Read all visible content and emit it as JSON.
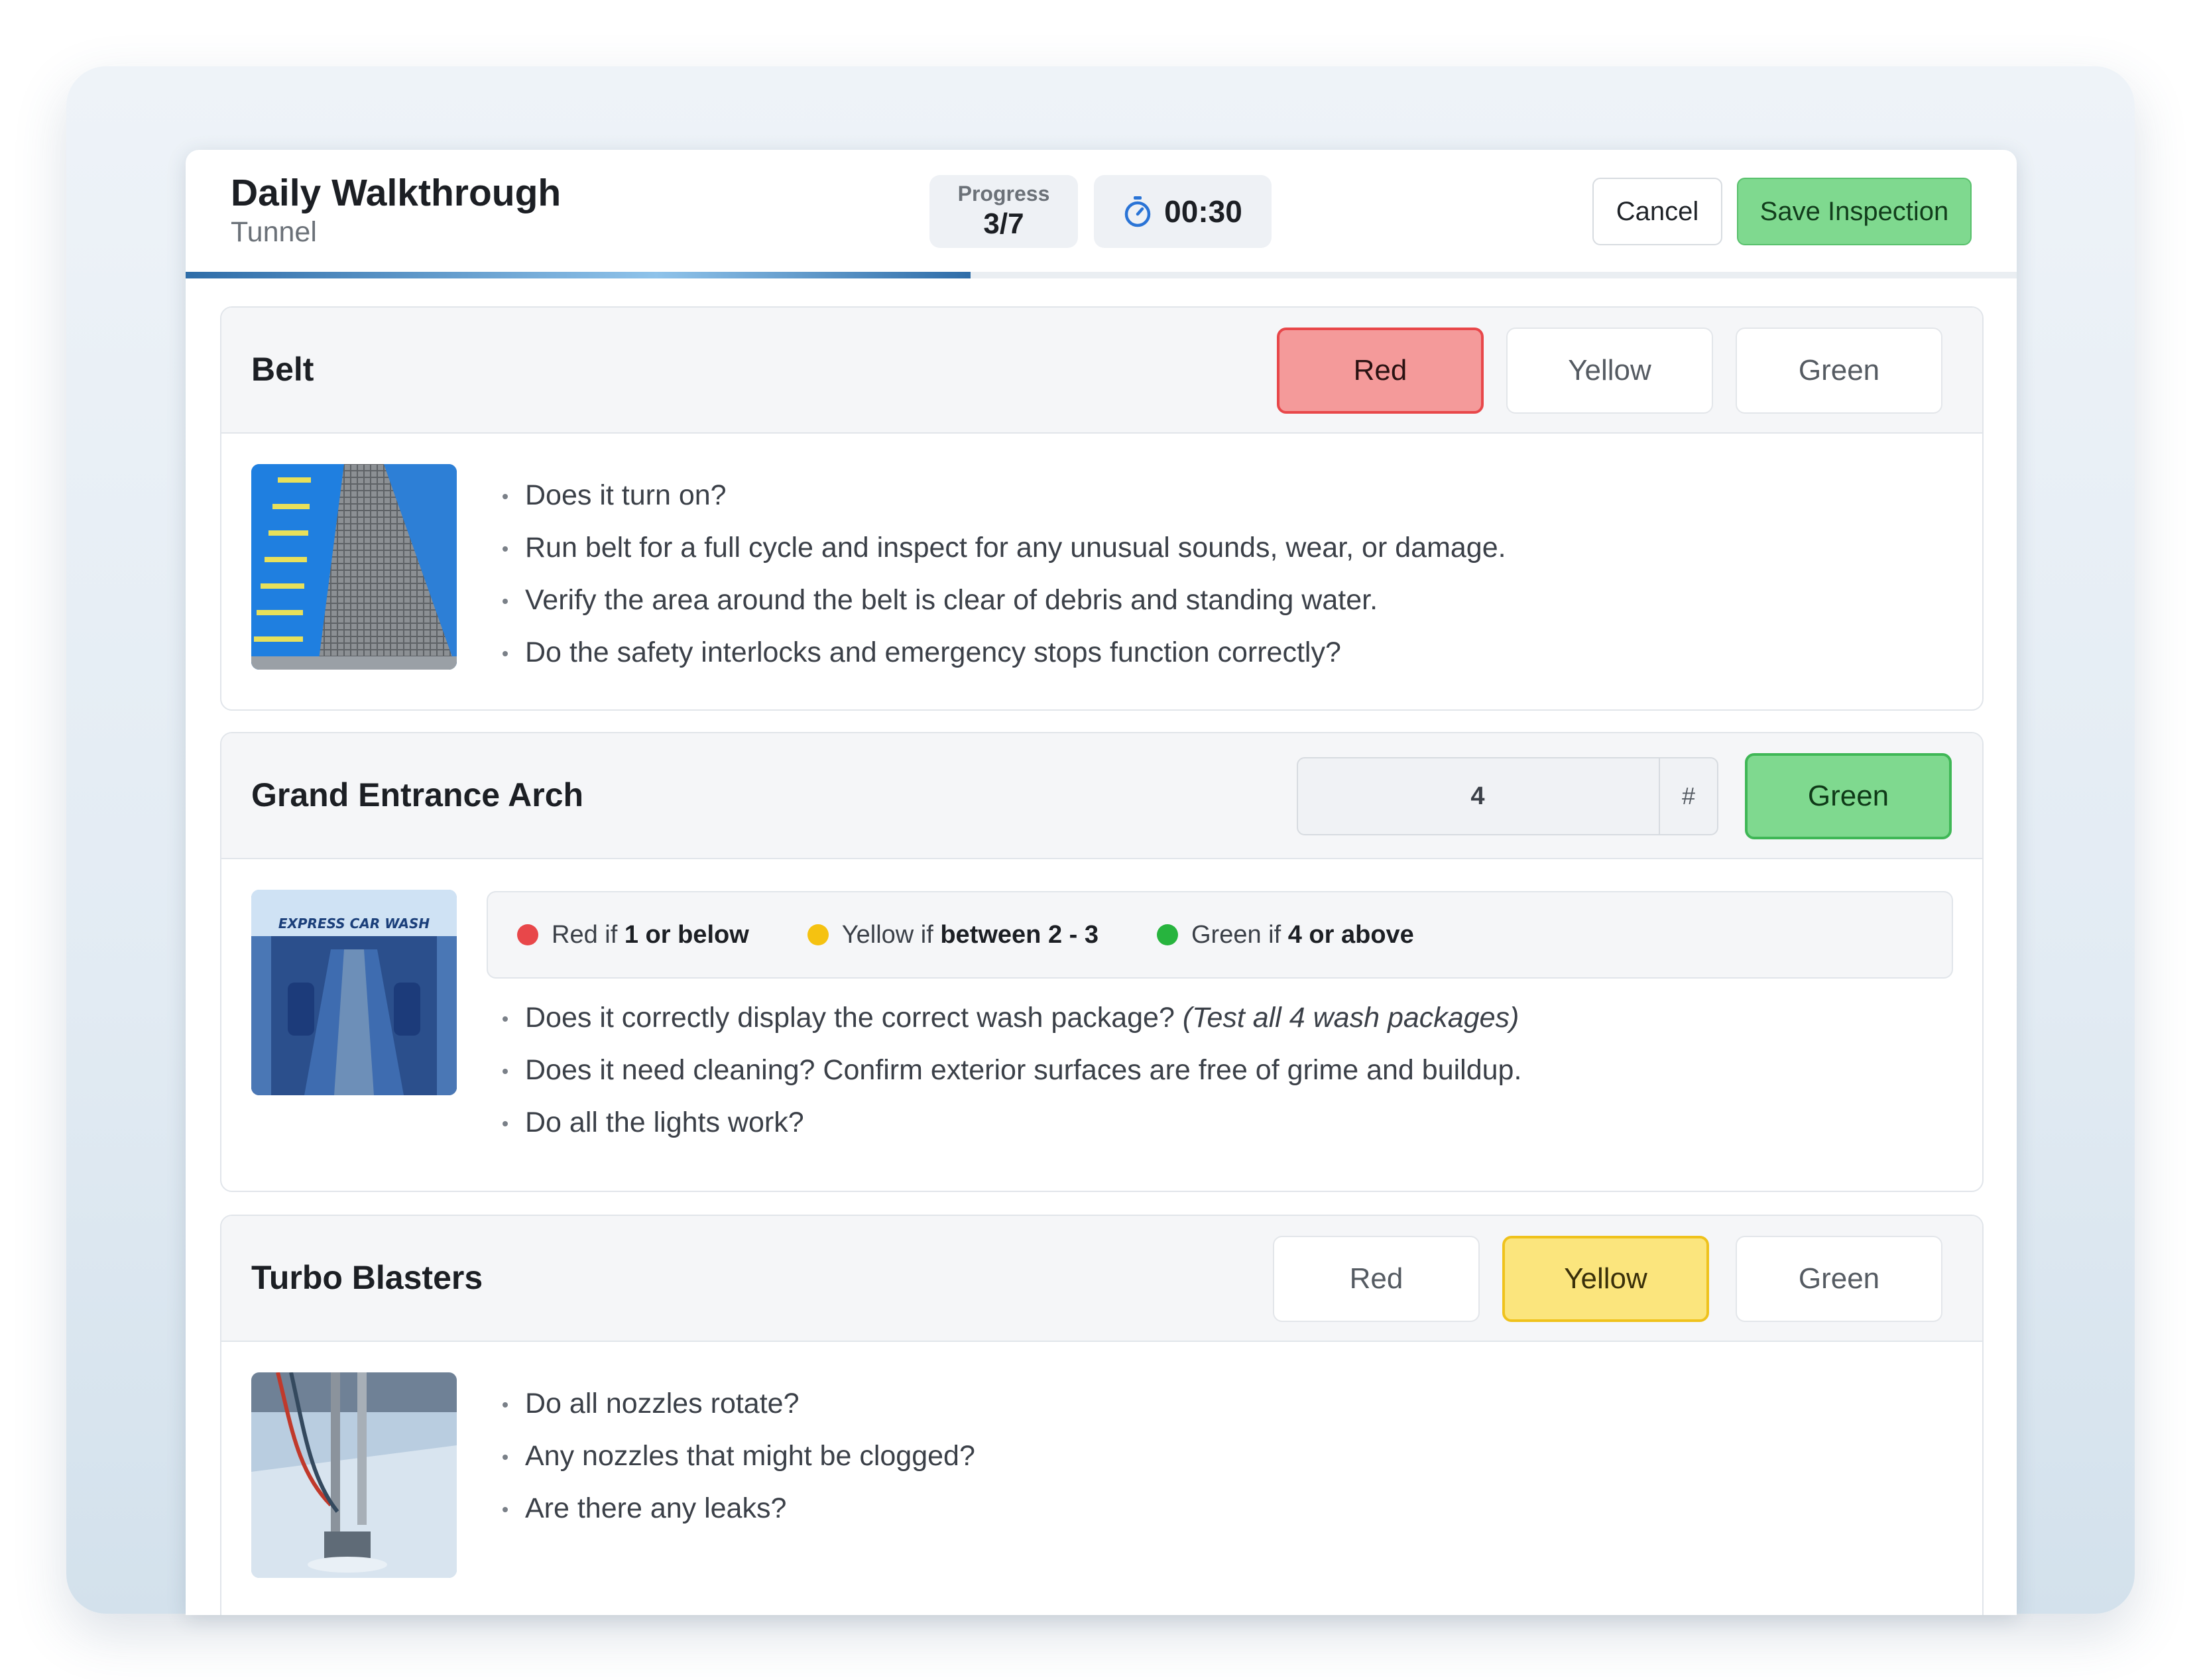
{
  "header": {
    "title": "Daily Walkthrough",
    "subtitle": "Tunnel",
    "progress_label": "Progress",
    "progress_value": "3/7",
    "progress_fraction": 0.4286,
    "timer": "00:30",
    "cancel_label": "Cancel",
    "save_label": "Save Inspection"
  },
  "colors": {
    "red": "#e8474a",
    "yellow": "#efc21c",
    "green": "#3fb756",
    "save_button": "#7fd98f",
    "progress_bar": "#2f6da8"
  },
  "items": [
    {
      "title": "Belt",
      "rating_options": [
        "Red",
        "Yellow",
        "Green"
      ],
      "selected": "Red",
      "image": "conveyor-belt-photo",
      "checklist": [
        "Does it turn on?",
        "Run belt for a full cycle and inspect for any unusual sounds, wear, or damage.",
        "Verify the area around the belt is clear of debris and standing water.",
        "Do the safety interlocks and emergency stops function correctly?"
      ]
    },
    {
      "title": "Grand Entrance Arch",
      "input_value": "4",
      "input_unit": "#",
      "computed_rating": "Green",
      "image": "entrance-arch-photo",
      "image_caption": "EXPRESS CAR WASH",
      "legend": [
        {
          "prefix": "Red if",
          "rule": "1 or below",
          "color": "#e8474a"
        },
        {
          "prefix": "Yellow if",
          "rule": "between 2 - 3",
          "color": "#f5c211"
        },
        {
          "prefix": "Green if",
          "rule": "4 or above",
          "color": "#27b43e"
        }
      ],
      "checklist": [
        "Does it correctly display the correct wash package?",
        "Does it need cleaning? Confirm exterior surfaces are free of grime and buildup.",
        "Do all the lights work?"
      ],
      "checklist_note": "(Test all 4 wash packages)"
    },
    {
      "title": "Turbo Blasters",
      "rating_options": [
        "Red",
        "Yellow",
        "Green"
      ],
      "selected": "Yellow",
      "image": "turbo-blaster-photo",
      "checklist": [
        "Do all nozzles rotate?",
        "Any nozzles that might be clogged?",
        "Are there any leaks?"
      ]
    }
  ]
}
